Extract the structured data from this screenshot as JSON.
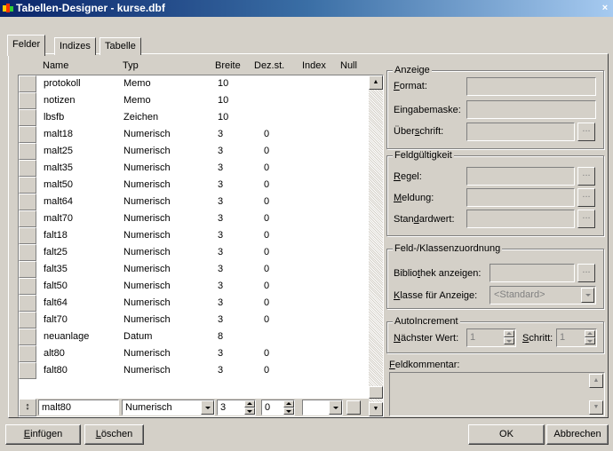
{
  "window": {
    "title": "Tabellen-Designer - kurse.dbf",
    "close_label": "×"
  },
  "tabs": [
    {
      "label": "Felder",
      "active": true
    },
    {
      "label": "Indizes",
      "active": false
    },
    {
      "label": "Tabelle",
      "active": false
    }
  ],
  "grid": {
    "columns": [
      "Name",
      "Typ",
      "Breite",
      "Dez.st.",
      "Index",
      "Null"
    ],
    "rows": [
      {
        "name": "protokoll",
        "typ": "Memo",
        "breite": "10",
        "dez": ""
      },
      {
        "name": "notizen",
        "typ": "Memo",
        "breite": "10",
        "dez": ""
      },
      {
        "name": "lbsfb",
        "typ": "Zeichen",
        "breite": "10",
        "dez": ""
      },
      {
        "name": "malt18",
        "typ": "Numerisch",
        "breite": "3",
        "dez": "0"
      },
      {
        "name": "malt25",
        "typ": "Numerisch",
        "breite": "3",
        "dez": "0"
      },
      {
        "name": "malt35",
        "typ": "Numerisch",
        "breite": "3",
        "dez": "0"
      },
      {
        "name": "malt50",
        "typ": "Numerisch",
        "breite": "3",
        "dez": "0"
      },
      {
        "name": "malt64",
        "typ": "Numerisch",
        "breite": "3",
        "dez": "0"
      },
      {
        "name": "malt70",
        "typ": "Numerisch",
        "breite": "3",
        "dez": "0"
      },
      {
        "name": "falt18",
        "typ": "Numerisch",
        "breite": "3",
        "dez": "0"
      },
      {
        "name": "falt25",
        "typ": "Numerisch",
        "breite": "3",
        "dez": "0"
      },
      {
        "name": "falt35",
        "typ": "Numerisch",
        "breite": "3",
        "dez": "0"
      },
      {
        "name": "falt50",
        "typ": "Numerisch",
        "breite": "3",
        "dez": "0"
      },
      {
        "name": "falt64",
        "typ": "Numerisch",
        "breite": "3",
        "dez": "0"
      },
      {
        "name": "falt70",
        "typ": "Numerisch",
        "breite": "3",
        "dez": "0"
      },
      {
        "name": "neuanlage",
        "typ": "Datum",
        "breite": "8",
        "dez": ""
      },
      {
        "name": "alt80",
        "typ": "Numerisch",
        "breite": "3",
        "dez": "0"
      },
      {
        "name": "falt80",
        "typ": "Numerisch",
        "breite": "3",
        "dez": "0"
      }
    ],
    "edit_row": {
      "marker": "↕",
      "name": "malt80",
      "typ": "Numerisch",
      "breite": "3",
      "dez": "0",
      "index": ""
    }
  },
  "anzeige": {
    "title": "Anzeige",
    "format_label": "Format:",
    "eingabemaske_label": "Eingabemaske:",
    "ueberschrift_label": "Überschrift:",
    "dots": "..."
  },
  "feldgueltigkeit": {
    "title": "Feldgültigkeit",
    "regel_label": "Regel:",
    "meldung_label": "Meldung:",
    "standardwert_label": "Standardwert:"
  },
  "klassen": {
    "title": "Feld-/Klassenzuordnung",
    "bibliothek_label": "Bibliothek anzeigen:",
    "klasse_label": "Klasse für Anzeige:",
    "klasse_value": "<Standard>"
  },
  "autoincrement": {
    "title": "AutoIncrement",
    "naechster_label": "Nächster Wert:",
    "naechster_value": "1",
    "schritt_label": "Schritt:",
    "schritt_value": "1"
  },
  "feldkommentar": {
    "label": "Feldkommentar:"
  },
  "buttons": {
    "einfuegen": "Einfügen",
    "loeschen": "Löschen",
    "ok": "OK",
    "abbrechen": "Abbrechen"
  }
}
